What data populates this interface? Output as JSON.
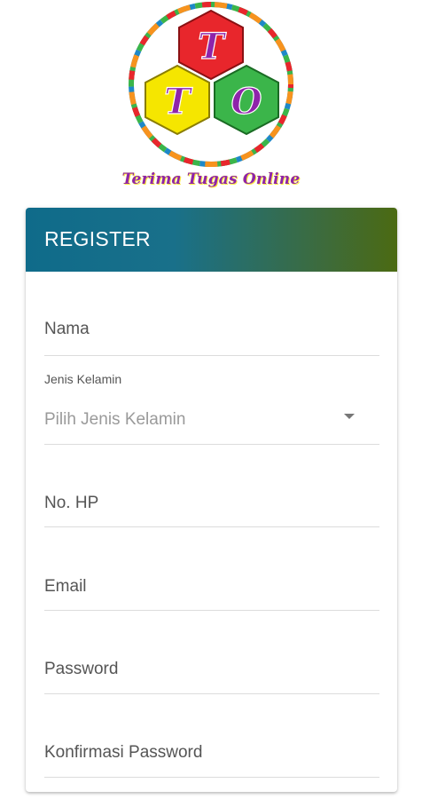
{
  "logo": {
    "letters": [
      "T",
      "T",
      "O"
    ],
    "caption": "Terima Tugas Online",
    "colors": {
      "red": "#e8262c",
      "yellow": "#f5e600",
      "green": "#3bb54a",
      "purple": "#8e24aa",
      "blue": "#1e88c8",
      "orange": "#f7931e"
    }
  },
  "form": {
    "title": "REGISTER",
    "header_colors": [
      "#0f6b8a",
      "#4b6a12"
    ],
    "fields": {
      "nama": {
        "placeholder": "Nama"
      },
      "gender": {
        "label": "Jenis Kelamin",
        "placeholder": "Pilih Jenis Kelamin"
      },
      "hp": {
        "placeholder": "No. HP"
      },
      "email": {
        "placeholder": "Email"
      },
      "password": {
        "placeholder": "Password"
      },
      "confirm": {
        "placeholder": "Konfirmasi Password"
      }
    }
  }
}
